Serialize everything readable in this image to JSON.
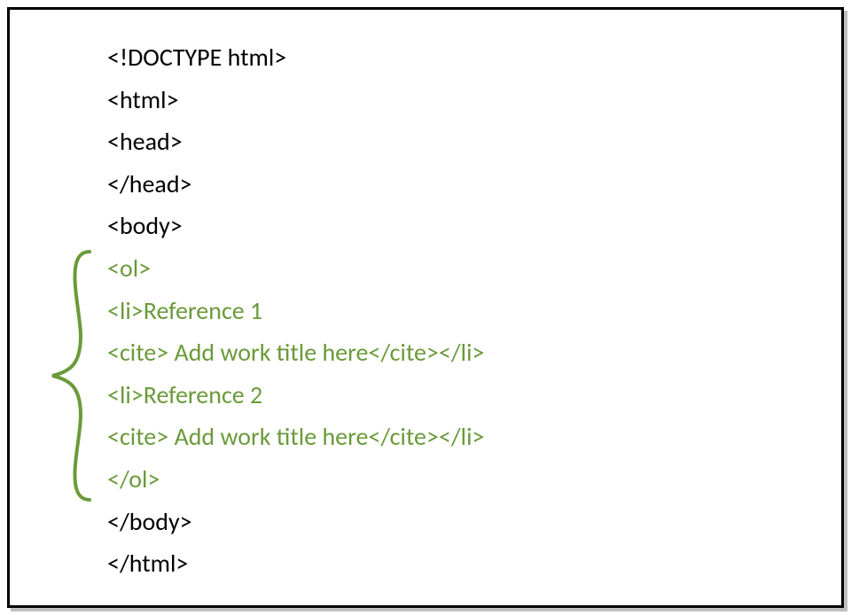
{
  "colors": {
    "text_default": "#000000",
    "text_highlight": "#6a9a3a",
    "frame_border": "#000000"
  },
  "lines": {
    "l1": "<!DOCTYPE html>",
    "l2": "<html>",
    "l3": "<head>",
    "l4": "</head>",
    "l5": "<body>",
    "l6": "<ol>",
    "l7": "<li>Reference 1",
    "l8": "<cite> Add work title here</cite></li>",
    "l9": "<li>Reference 2",
    "l10": "<cite> Add work title here</cite></li>",
    "l11": "</ol>",
    "l12": "</body>",
    "l13": "</html>"
  }
}
